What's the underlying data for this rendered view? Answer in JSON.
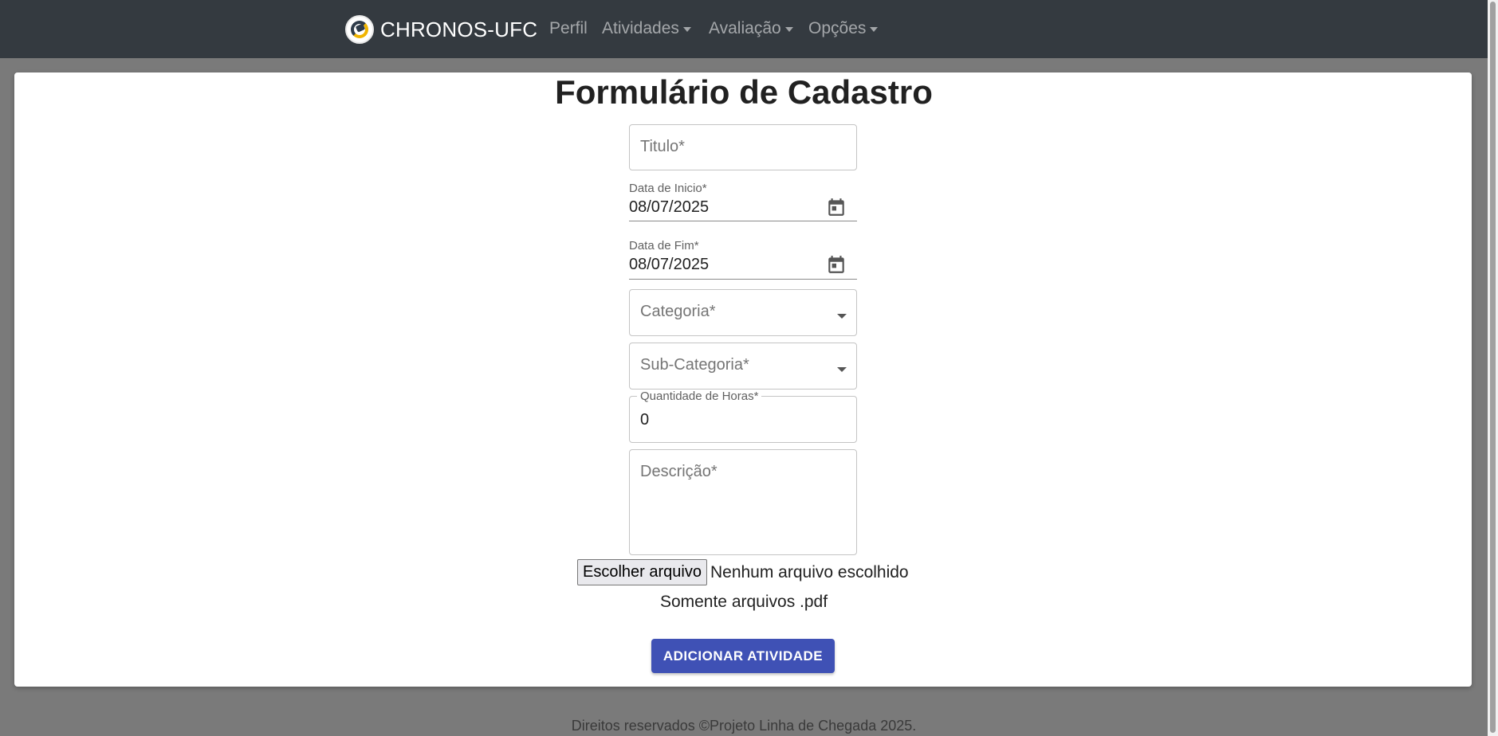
{
  "navbar": {
    "brand": "CHRONOS-UFC",
    "items": [
      {
        "label": "Perfil"
      },
      {
        "label": "Atividades"
      },
      {
        "label": "Avaliação"
      },
      {
        "label": "Opções"
      }
    ]
  },
  "form": {
    "title": "Formulário de Cadastro",
    "titulo": {
      "placeholder": "Titulo*",
      "value": ""
    },
    "data_inicio": {
      "label": "Data de Inicio*",
      "value": "08/07/2025"
    },
    "data_fim": {
      "label": "Data de Fim*",
      "value": "08/07/2025"
    },
    "categoria": {
      "placeholder": "Categoria*"
    },
    "sub_categoria": {
      "placeholder": "Sub-Categoria*"
    },
    "quantidade_horas": {
      "label": "Quantidade de Horas*",
      "value": "0"
    },
    "descricao": {
      "placeholder": "Descrição*"
    },
    "file": {
      "button_label": "Escolher arquivo",
      "status": "Nenhum arquivo escolhido"
    },
    "file_note": "Somente arquivos .pdf",
    "submit_label": "ADICIONAR ATIVIDADE"
  },
  "footer": {
    "text": "Direitos reservados ©Projeto Linha de Chegada 2025."
  },
  "colors": {
    "navbar": "#343a40",
    "primary_button": "#3f51b5",
    "backdrop": "#7a7a7a"
  },
  "icons": {
    "brand": "chronos-logo-icon",
    "date": "calendar-icon",
    "dropdown": "caret-down-icon"
  }
}
